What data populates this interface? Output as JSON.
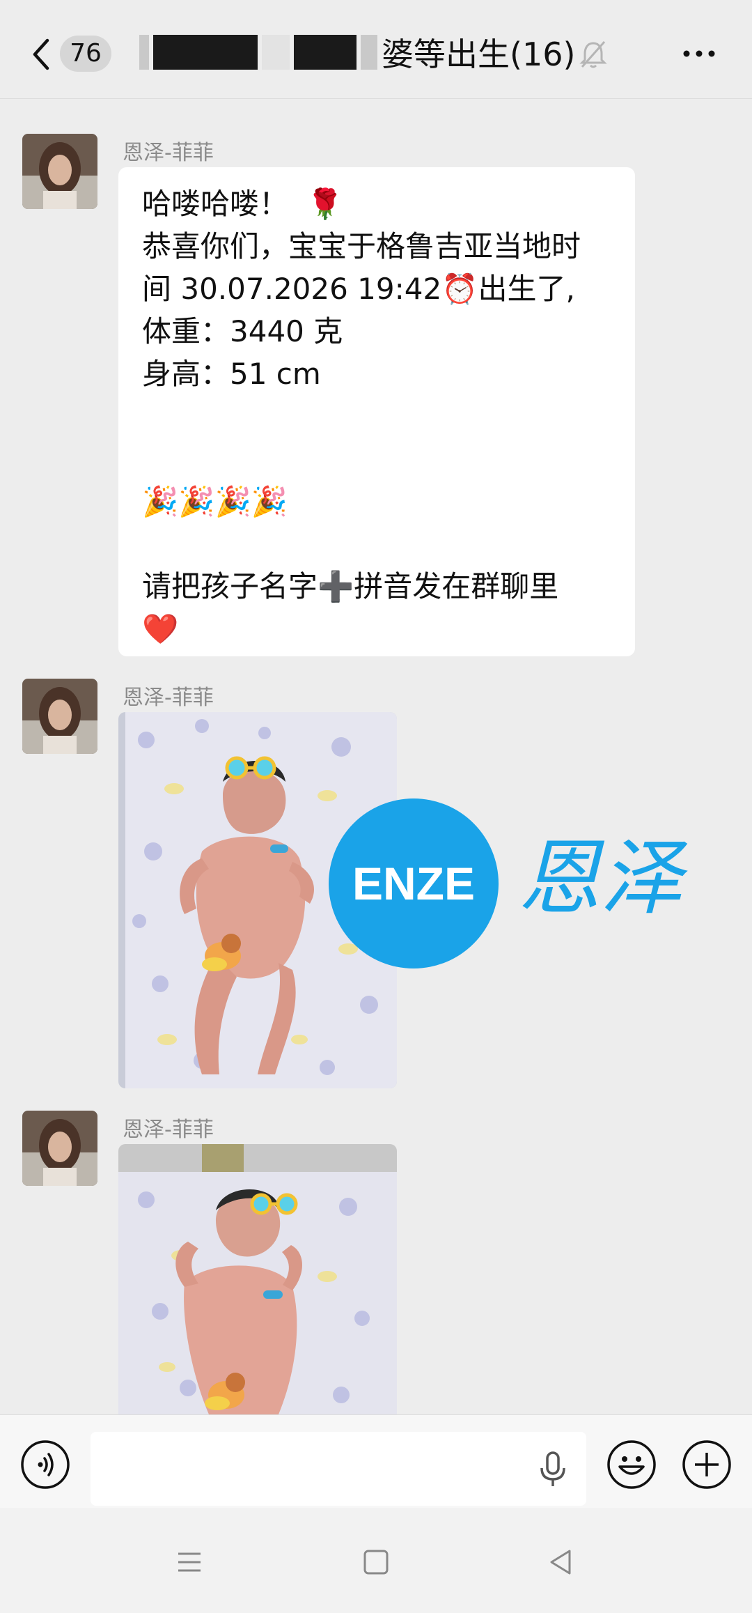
{
  "header": {
    "unread_count": "76",
    "title_visible": "婆等出生(16)"
  },
  "messages": [
    {
      "sender": "恩泽-菲菲",
      "type": "text",
      "lines": [
        "哈喽哈喽！  🌹",
        "恭喜你们，宝宝于格鲁吉亚当地时",
        "间 30.07.2026 19:42⏰出生了,",
        "体重：3440 克",
        "身高：51 cm",
        "",
        "",
        "🎉🎉🎉🎉",
        "",
        "请把孩子名字➕拼音发在群聊里",
        "❤️"
      ]
    },
    {
      "sender": "恩泽-菲菲",
      "type": "image"
    },
    {
      "sender": "恩泽-菲菲",
      "type": "image"
    }
  ],
  "watermark": {
    "badge_text": "ENZE",
    "chinese_text": "恩泽"
  },
  "icons": {
    "back": "chevron-left-icon",
    "mute": "bell-off-icon",
    "more": "more-dots-icon",
    "voice": "voice-input-icon",
    "mic": "microphone-icon",
    "emoji": "emoji-icon",
    "plus": "plus-icon",
    "nav_menu": "menu-icon",
    "nav_home": "home-square-icon",
    "nav_back": "back-triangle-icon"
  },
  "colors": {
    "bubble": "#ffffff",
    "background": "#ededed",
    "watermark_blue": "#1aa3e8"
  }
}
